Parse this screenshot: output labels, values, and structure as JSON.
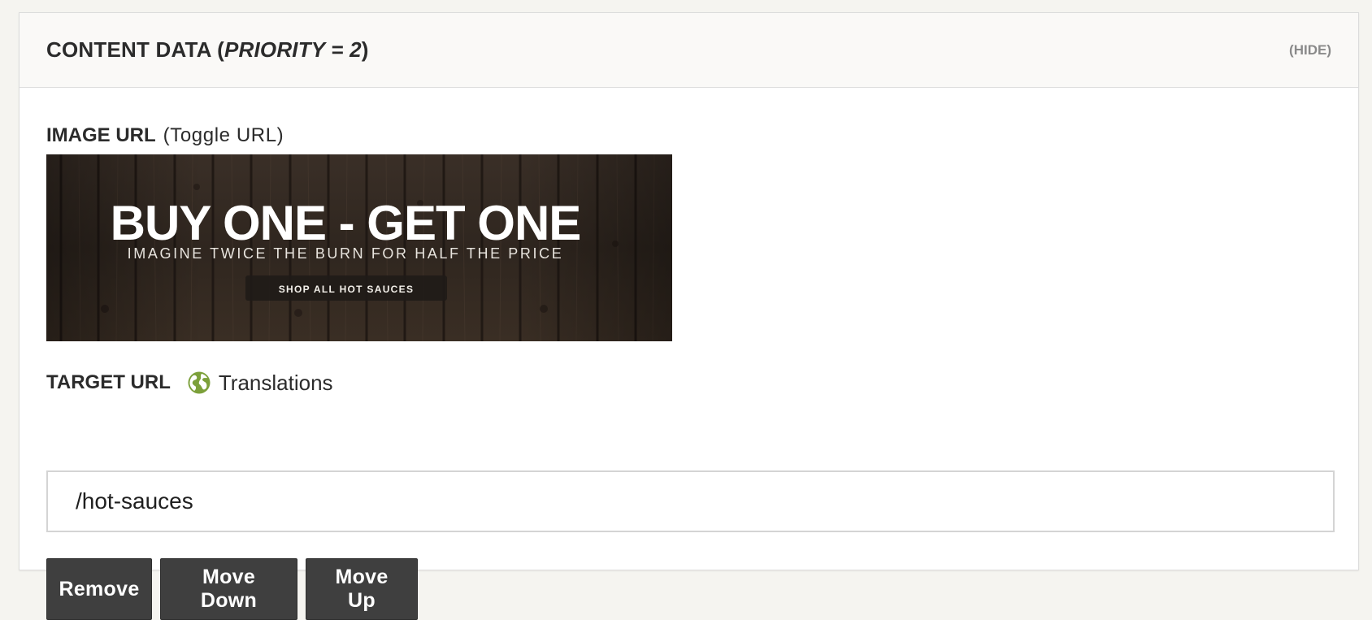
{
  "panel": {
    "title_prefix": "CONTENT DATA (",
    "title_priority": "PRIORITY = 2",
    "title_suffix": ")",
    "hide_label": "(HIDE)"
  },
  "image_field": {
    "label": "IMAGE URL",
    "toggle_label": "(Toggle URL)",
    "banner": {
      "headline": "BUY ONE - GET ONE",
      "subline": "IMAGINE TWICE THE BURN FOR HALF THE PRICE",
      "cta": "SHOP ALL HOT SAUCES"
    }
  },
  "target_field": {
    "label": "TARGET URL",
    "translations_icon": "globe-icon",
    "translations_label": "Translations",
    "value": "/hot-sauces",
    "placeholder": ""
  },
  "actions": {
    "remove_label": "Remove",
    "move_down_label": "Move Down",
    "move_up_label": "Move Up"
  },
  "colors": {
    "button_bg": "#3f3f3f",
    "globe_green": "#7ca03a",
    "banner_wood": "#2e241d"
  }
}
